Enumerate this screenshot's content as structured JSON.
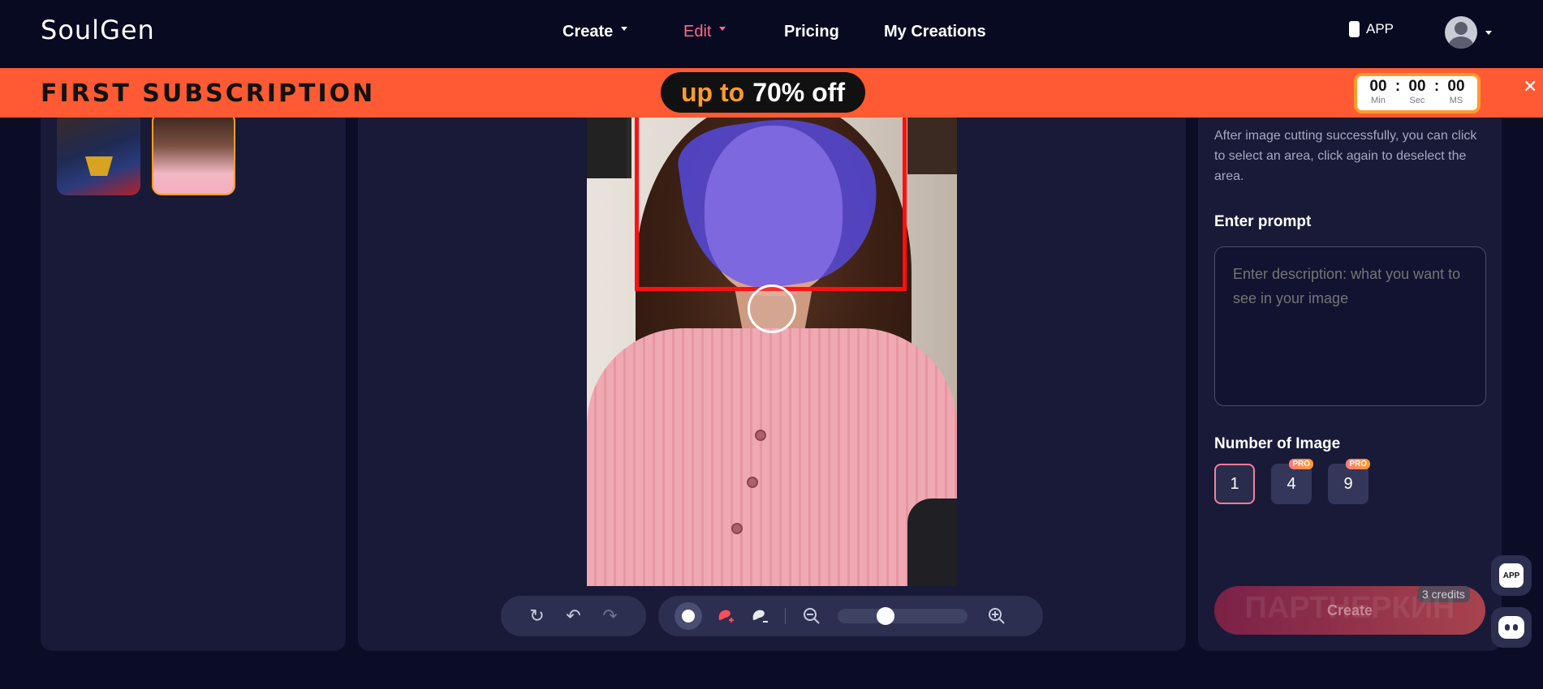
{
  "header": {
    "logo": "SoulGen",
    "nav": [
      {
        "label": "Create",
        "has_caret": true,
        "active": false
      },
      {
        "label": "Edit",
        "has_caret": true,
        "active": true
      },
      {
        "label": "Pricing",
        "has_caret": false,
        "active": false
      },
      {
        "label": "My Creations",
        "has_caret": false,
        "active": false
      }
    ],
    "app_label": "APP",
    "avatar_icon": "user-avatar-icon"
  },
  "promo": {
    "title": "FIRST SUBSCRIPTION",
    "offer_prefix": "up to",
    "offer_value": "70% off",
    "timer": {
      "min": "00",
      "sec": "00",
      "ms": "00",
      "min_label": "Min",
      "sec_label": "Sec",
      "ms_label": "MS",
      "sep": ":"
    },
    "close_icon": "close-icon"
  },
  "left_panel": {
    "thumbnails": [
      "superhero thumbnail",
      "woman in pink sweater thumbnail"
    ],
    "selected_index": 1
  },
  "editor": {
    "toolbar_history": [
      {
        "icon": "refresh-icon",
        "glyph": "↻"
      },
      {
        "icon": "undo-icon",
        "glyph": "↶"
      },
      {
        "icon": "redo-icon",
        "glyph": "↷"
      }
    ],
    "toolbar_tools": {
      "brush_icon": "brush-dot-icon",
      "brush_add_icon": "brush-add-icon",
      "brush_remove_icon": "brush-remove-icon",
      "zoom_out_icon": "zoom-out-icon",
      "zoom_in_icon": "zoom-in-icon",
      "zoom_level": 0.35
    }
  },
  "right_panel": {
    "hint": "After image cutting successfully, you can click to select an area, click again to deselect the area.",
    "prompt_label": "Enter prompt",
    "prompt_placeholder": "Enter description: what you want to see in your image",
    "number_label": "Number of Image",
    "number_options": [
      {
        "value": "1",
        "pro": false,
        "selected": true
      },
      {
        "value": "4",
        "pro": true,
        "selected": false
      },
      {
        "value": "9",
        "pro": true,
        "selected": false
      }
    ],
    "pro_badge": "PRO",
    "create_label": "Create",
    "credits": "3 credits",
    "watermark": "ПАРТНЕРКИН"
  },
  "floating": {
    "app_label": "APP",
    "chat_icon": "chat-bot-icon"
  },
  "colors": {
    "background": "#0b0d26",
    "panel": "#181a38",
    "promo": "#ff5a33",
    "accent": "#ff9b2b",
    "active_nav": "#ff6b86",
    "mask": "#5a50ff",
    "selection": "#ff1010"
  }
}
